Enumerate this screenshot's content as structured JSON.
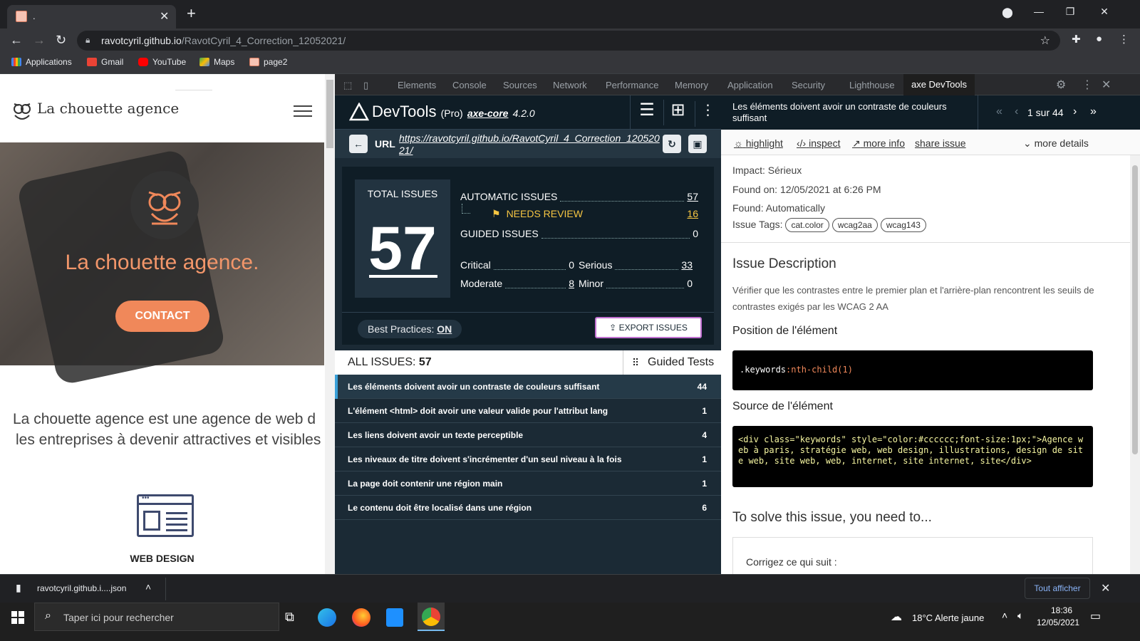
{
  "browser": {
    "tab_title": ".",
    "url_domain": "ravotcyril.github.io",
    "url_path": "/RavotCyril_4_Correction_12052021/",
    "bookmarks": [
      "Applications",
      "Gmail",
      "YouTube",
      "Maps",
      "page2"
    ]
  },
  "site": {
    "brand": "La chouette agence",
    "hero_title": "La chouette agence.",
    "contact_label": "CONTACT",
    "intro_line1": "La chouette agence est une agence de web d",
    "intro_line2": "les entreprises à devenir attractives et visibles",
    "service_label": "WEB DESIGN"
  },
  "devtools": {
    "tabs": [
      "Elements",
      "Console",
      "Sources",
      "Network",
      "Performance",
      "Memory",
      "Application",
      "Security",
      "Lighthouse"
    ],
    "active_tab": "axe DevTools"
  },
  "axe": {
    "title": "DevTools",
    "edition": "(Pro)",
    "engine": "axe-core",
    "version": "4.2.0",
    "url_label": "URL",
    "url_value": "https://ravotcyril.github.io/RavotCyril_4_Correction_12052021/",
    "total_label": "TOTAL ISSUES",
    "total": "57",
    "automatic_label": "AUTOMATIC ISSUES",
    "automatic": "57",
    "needs_review_label": "NEEDS REVIEW",
    "needs_review": "16",
    "guided_label": "GUIDED ISSUES",
    "guided": "0",
    "critical_label": "Critical",
    "critical": "0",
    "serious_label": "Serious",
    "serious": "33",
    "moderate_label": "Moderate",
    "moderate": "8",
    "minor_label": "Minor",
    "minor": "0",
    "best_practices_label": "Best Practices:",
    "best_practices_value": "ON",
    "export_label": "EXPORT ISSUES",
    "all_issues_label": "ALL ISSUES:",
    "all_issues_count": "57",
    "guided_tests_label": "Guided Tests",
    "issues": [
      {
        "title": "Les éléments doivent avoir un contraste de couleurs suffisant",
        "count": "44"
      },
      {
        "title": "L'élément <html> doit avoir une valeur valide pour l'attribut lang",
        "count": "1"
      },
      {
        "title": "Les liens doivent avoir un texte perceptible",
        "count": "4"
      },
      {
        "title": "Les niveaux de titre doivent s'incrémenter d'un seul niveau à la fois",
        "count": "1"
      },
      {
        "title": "La page doit contenir une région main",
        "count": "1"
      },
      {
        "title": "Le contenu doit être localisé dans une région",
        "count": "6"
      }
    ]
  },
  "detail": {
    "title": "Les éléments doivent avoir un contraste de couleurs suffisant",
    "pager": "1 sur 44",
    "links": {
      "highlight": "highlight",
      "inspect": "inspect",
      "more_info": "more info",
      "share": "share issue",
      "more_details": "more details"
    },
    "impact": "Impact: Sérieux",
    "found_on": "Found on: 12/05/2021 at 6:26 PM",
    "found": "Found: Automatically",
    "tags_label": "Issue Tags:",
    "tags": [
      "cat.color",
      "wcag2aa",
      "wcag143"
    ],
    "desc_heading": "Issue Description",
    "desc": "Vérifier que les contrastes entre le premier plan et l'arrière-plan rencontrent les seuils de contrastes exigés par les WCAG 2 AA",
    "position_heading": "Position de l'élément",
    "selector_class": ".keywords",
    "selector_pseudo": ":nth-child(1)",
    "source_heading": "Source de l'élément",
    "source_code": "<div class=\"keywords\" style=\"color:#cccccc;font-size:1px;\">Agence web à paris, stratégie web, web design, illustrations, design de site web, site web, web, internet, site internet, site</div>",
    "solve_heading": "To solve this issue, you need to...",
    "solve_partial": "Corrigez ce qui suit :"
  },
  "download": {
    "file": "ravotcyril.github.i....json",
    "show_all": "Tout afficher"
  },
  "taskbar": {
    "search_placeholder": "Taper ici pour rechercher",
    "weather": "18°C  Alerte jaune",
    "time": "18:36",
    "date": "12/05/2021"
  },
  "colors": {
    "axe_bg": "#1b2a35",
    "accent_orange": "#f0885a",
    "needs_review": "#f5c542",
    "focus_border": "#c070d0"
  }
}
